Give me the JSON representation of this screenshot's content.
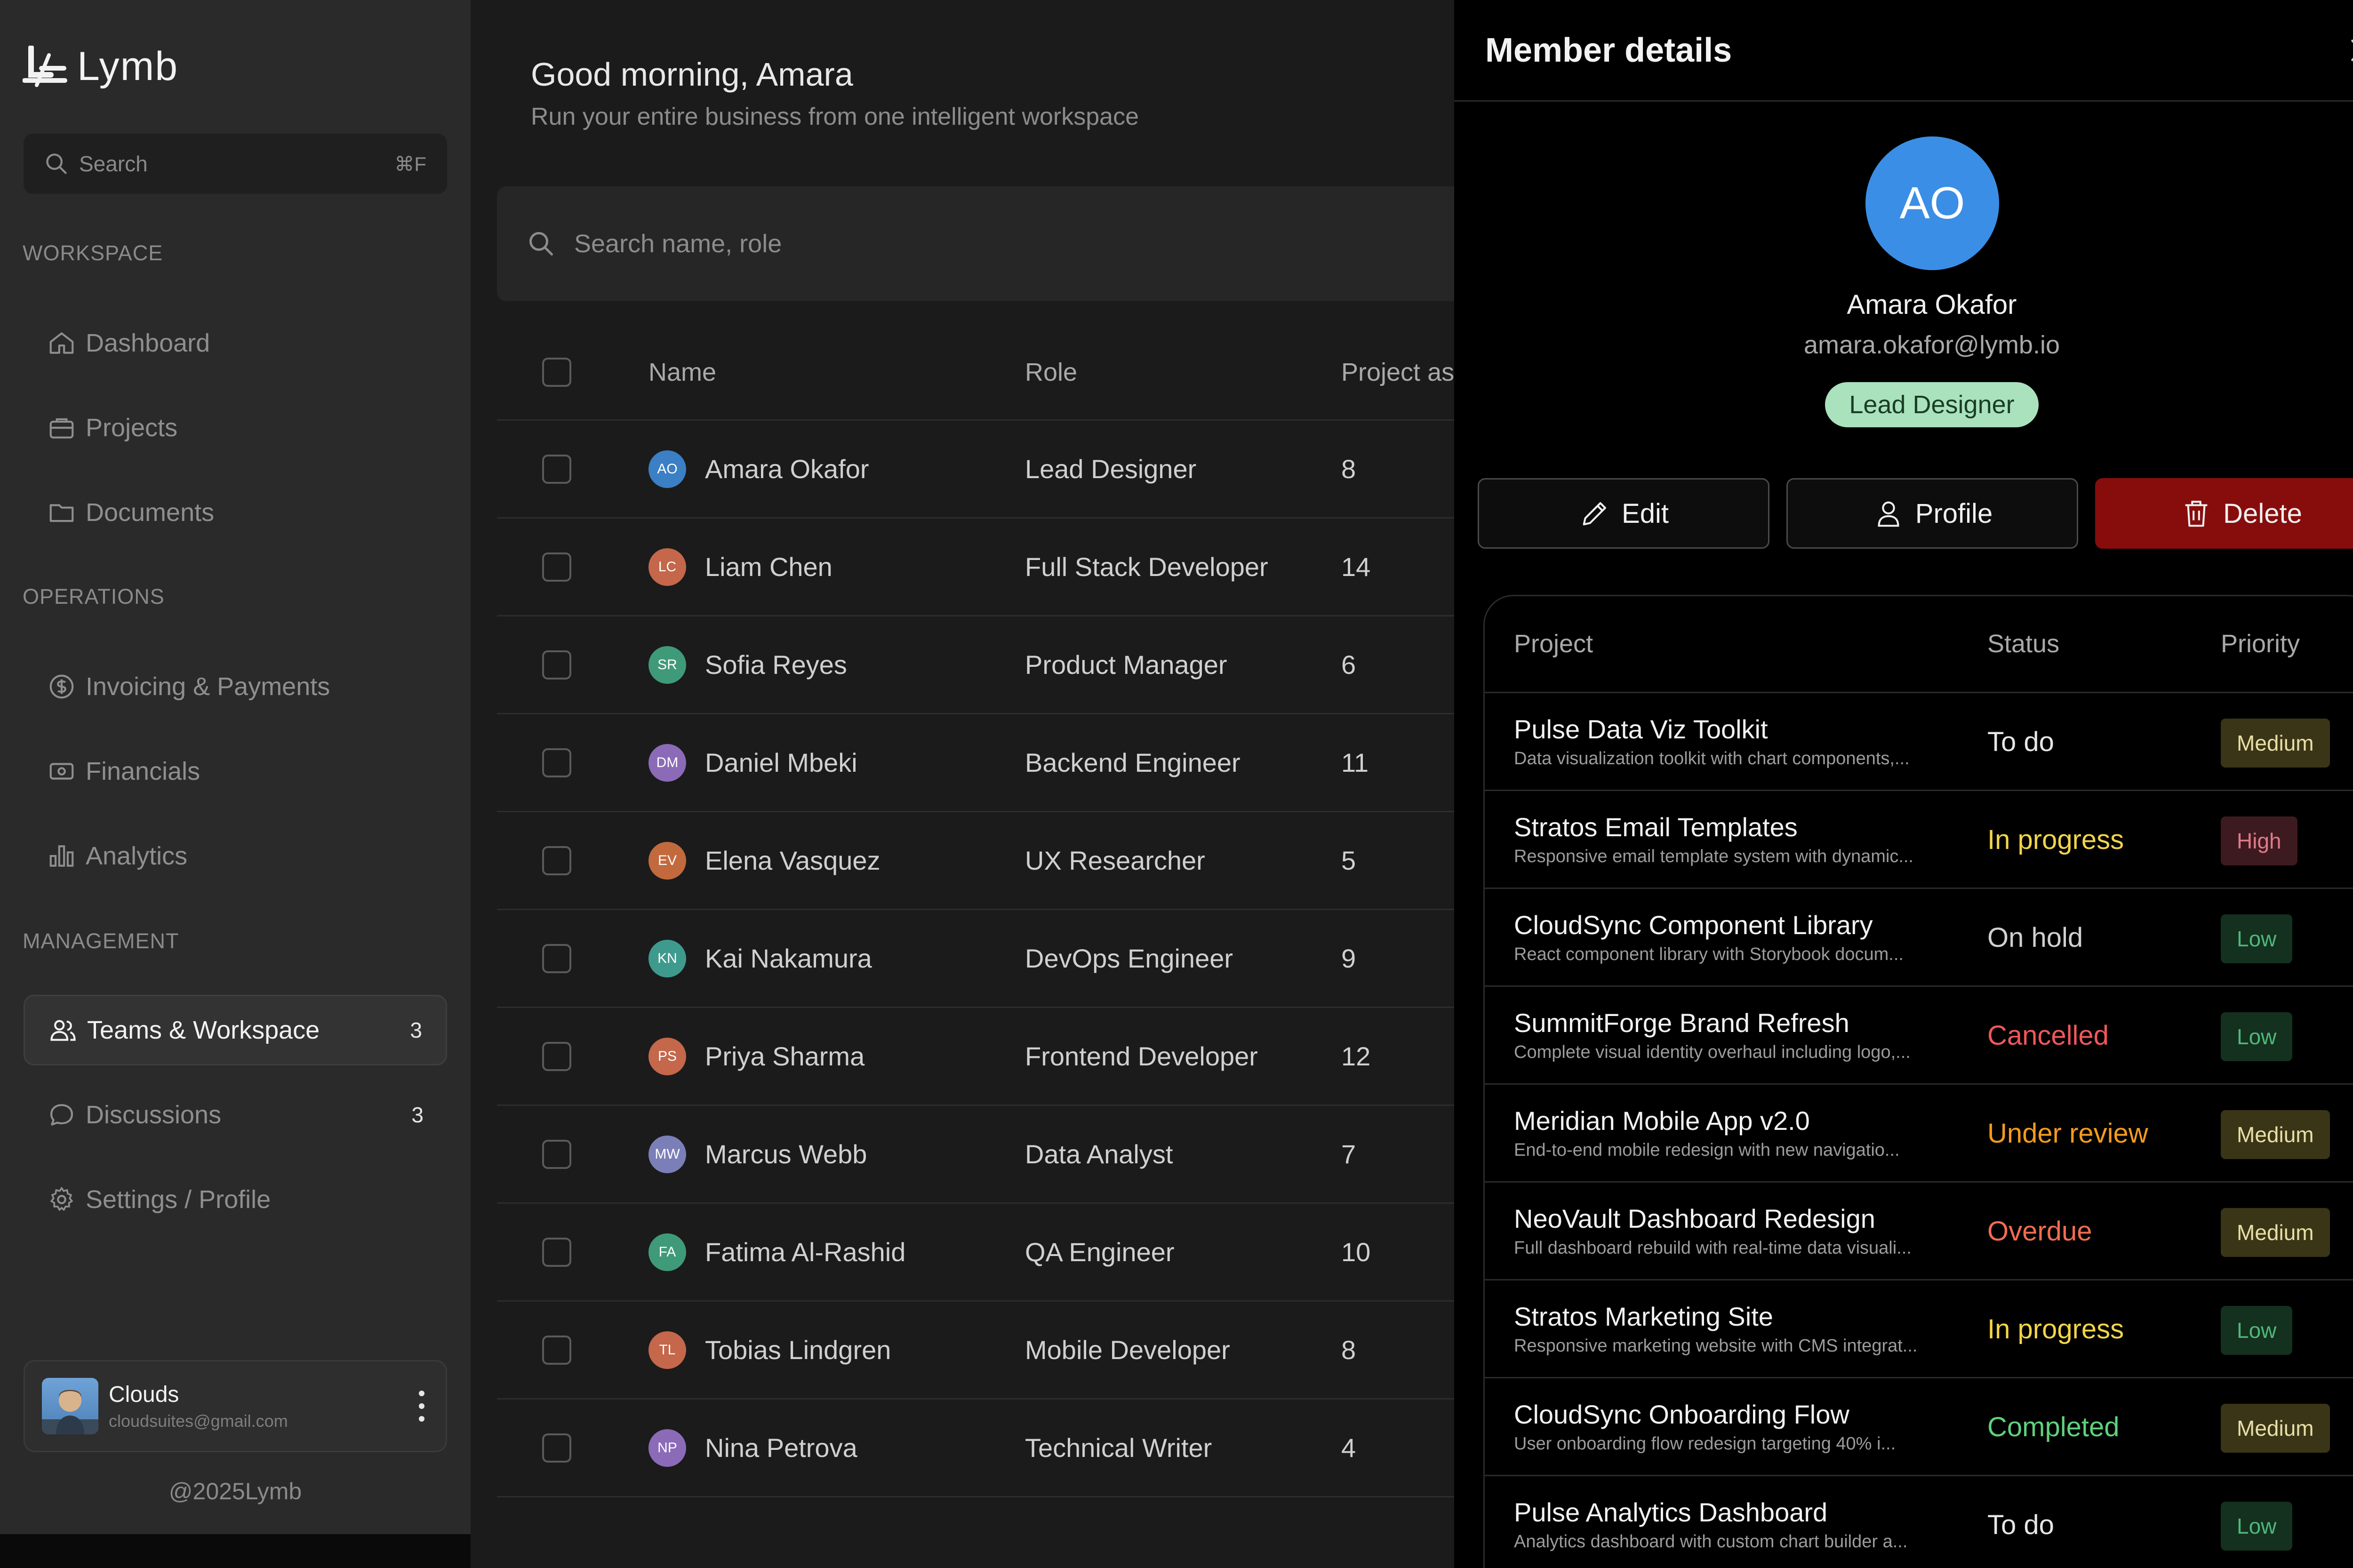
{
  "app": {
    "logo_text": "Lymb"
  },
  "sidebar": {
    "search": {
      "placeholder": "Search",
      "shortcut": "⌘F"
    },
    "sections": {
      "workspace": "WORKSPACE",
      "operations": "OPERATIONS",
      "management": "MANAGEMENT"
    },
    "items": {
      "dashboard": "Dashboard",
      "projects": "Projects",
      "documents": "Documents",
      "invoicing": "Invoicing & Payments",
      "financials": "Financials",
      "analytics": "Analytics",
      "teams": "Teams & Workspace",
      "teams_count": "3",
      "discussions": "Discussions",
      "discussions_count": "3",
      "settings": "Settings / Profile"
    },
    "user": {
      "name": "Clouds",
      "email": "cloudsuites@gmail.com"
    },
    "copyright": "@2025Lymb"
  },
  "main": {
    "greeting": "Good morning, Amara",
    "subtitle": "Run your entire business from one intelligent workspace",
    "search_placeholder": "Search name, role",
    "columns": {
      "name": "Name",
      "role": "Role",
      "projects": "Project as"
    },
    "rows": [
      {
        "initials": "AO",
        "name": "Amara Okafor",
        "role": "Lead Designer",
        "projects": "8",
        "color": "#3b7fc4"
      },
      {
        "initials": "LC",
        "name": "Liam Chen",
        "role": "Full Stack Developer",
        "projects": "14",
        "color": "#c4674a"
      },
      {
        "initials": "SR",
        "name": "Sofia Reyes",
        "role": "Product Manager",
        "projects": "6",
        "color": "#3f9a7a"
      },
      {
        "initials": "DM",
        "name": "Daniel Mbeki",
        "role": "Backend Engineer",
        "projects": "11",
        "color": "#8b6bb8"
      },
      {
        "initials": "EV",
        "name": "Elena Vasquez",
        "role": "UX Researcher",
        "projects": "5",
        "color": "#c26a3e"
      },
      {
        "initials": "KN",
        "name": "Kai Nakamura",
        "role": "DevOps Engineer",
        "projects": "9",
        "color": "#3f9a8e"
      },
      {
        "initials": "PS",
        "name": "Priya Sharma",
        "role": "Frontend Developer",
        "projects": "12",
        "color": "#c4674a"
      },
      {
        "initials": "MW",
        "name": "Marcus Webb",
        "role": "Data Analyst",
        "projects": "7",
        "color": "#7b7fb8"
      },
      {
        "initials": "FA",
        "name": "Fatima Al-Rashid",
        "role": "QA Engineer",
        "projects": "10",
        "color": "#3f9a7a"
      },
      {
        "initials": "TL",
        "name": "Tobias Lindgren",
        "role": "Mobile Developer",
        "projects": "8",
        "color": "#c4674a"
      },
      {
        "initials": "NP",
        "name": "Nina Petrova",
        "role": "Technical Writer",
        "projects": "4",
        "color": "#8b6bb8"
      }
    ]
  },
  "drawer": {
    "title": "Member details",
    "initials": "AO",
    "name": "Amara Okafor",
    "email": "amara.okafor@lymb.io",
    "role_badge": "Lead Designer",
    "buttons": {
      "edit": "Edit",
      "profile": "Profile",
      "delete": "Delete"
    },
    "columns": {
      "project": "Project",
      "status": "Status",
      "priority": "Priority"
    },
    "projects": [
      {
        "name": "Pulse Data Viz Toolkit",
        "desc": "Data visualization toolkit with chart components,...",
        "status": "To do",
        "status_color": "#e6e6e6",
        "priority": "Medium",
        "prio_class": "prio-medium"
      },
      {
        "name": "Stratos Email Templates",
        "desc": "Responsive email template system with dynamic...",
        "status": "In progress",
        "status_color": "#f2d54a",
        "priority": "High",
        "prio_class": "prio-high"
      },
      {
        "name": "CloudSync Component Library",
        "desc": "React component library with Storybook docum...",
        "status": "On hold",
        "status_color": "#d0d0d0",
        "priority": "Low",
        "prio_class": "prio-low"
      },
      {
        "name": "SummitForge Brand Refresh",
        "desc": "Complete visual identity overhaul including logo,...",
        "status": "Cancelled",
        "status_color": "#f0575b",
        "priority": "Low",
        "prio_class": "prio-low"
      },
      {
        "name": "Meridian Mobile App v2.0",
        "desc": "End-to-end mobile redesign with new navigatio...",
        "status": "Under review",
        "status_color": "#f59a1f",
        "priority": "Medium",
        "prio_class": "prio-medium"
      },
      {
        "name": "NeoVault Dashboard Redesign",
        "desc": "Full dashboard rebuild with real-time data visuali...",
        "status": "Overdue",
        "status_color": "#f06d4f",
        "priority": "Medium",
        "prio_class": "prio-medium"
      },
      {
        "name": "Stratos Marketing Site",
        "desc": "Responsive marketing website with CMS integrat...",
        "status": "In progress",
        "status_color": "#f2d54a",
        "priority": "Low",
        "prio_class": "prio-low"
      },
      {
        "name": "CloudSync Onboarding Flow",
        "desc": "User onboarding flow redesign targeting 40% i...",
        "status": "Completed",
        "status_color": "#5fd17f",
        "priority": "Medium",
        "prio_class": "prio-medium"
      },
      {
        "name": "Pulse Analytics Dashboard",
        "desc": "Analytics dashboard with custom chart builder a...",
        "status": "To do",
        "status_color": "#e6e6e6",
        "priority": "Low",
        "prio_class": "prio-low"
      }
    ]
  }
}
